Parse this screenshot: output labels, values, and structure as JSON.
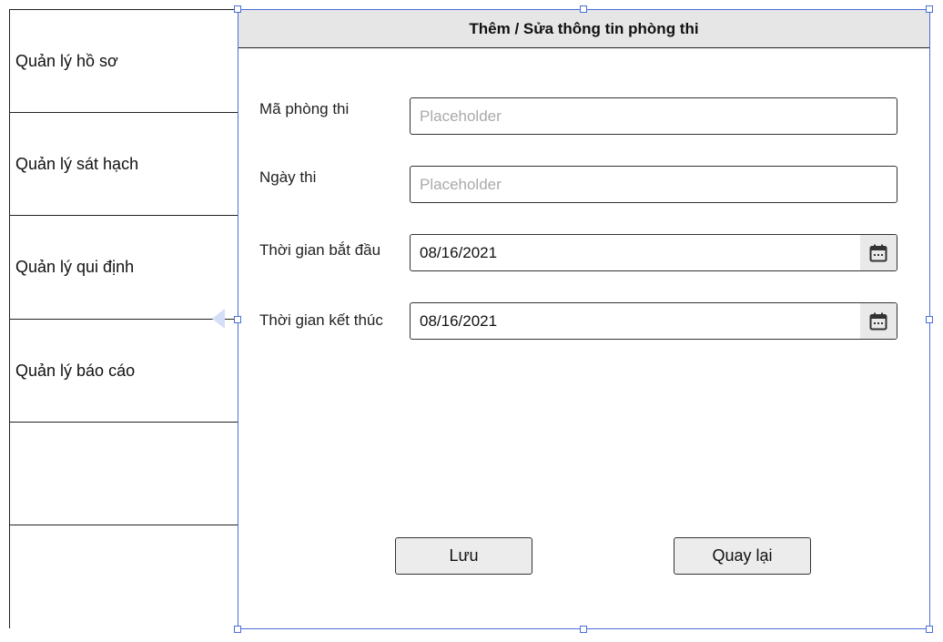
{
  "sidebar": {
    "items": [
      {
        "label": "Quản lý hồ sơ"
      },
      {
        "label": "Quản lý sát hạch"
      },
      {
        "label": "Quản lý qui định"
      },
      {
        "label": "Quản lý báo cáo"
      },
      {
        "label": ""
      },
      {
        "label": ""
      }
    ]
  },
  "form": {
    "title": "Thêm / Sửa thông tin phòng thi",
    "fields": {
      "room_code": {
        "label": "Mã phòng thi",
        "placeholder": "Placeholder",
        "value": ""
      },
      "exam_date": {
        "label": "Ngày thi",
        "placeholder": "Placeholder",
        "value": ""
      },
      "start_time": {
        "label": "Thời gian bắt đầu",
        "value": "08/16/2021",
        "icon": "calendar-icon"
      },
      "end_time": {
        "label": "Thời gian kết thúc",
        "value": "08/16/2021",
        "icon": "calendar-icon"
      }
    },
    "buttons": {
      "save": "Lưu",
      "back": "Quay lại"
    }
  },
  "colors": {
    "selection": "#4a6fd8",
    "header_bg": "#e6e6e6",
    "button_bg": "#ececec",
    "placeholder": "#aaaaaa"
  }
}
